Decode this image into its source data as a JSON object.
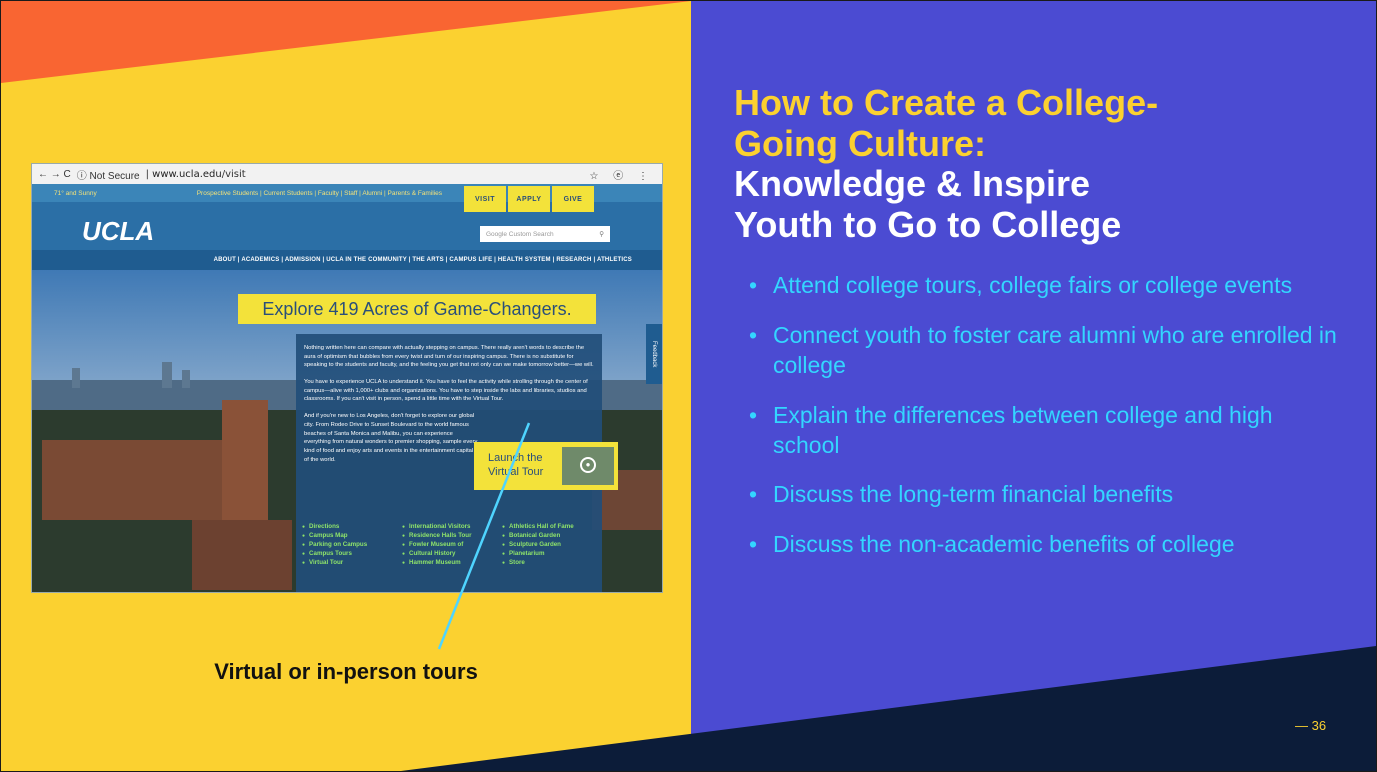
{
  "colors": {
    "yellow": "#fbd130",
    "orange": "#f96532",
    "purple": "#4b4bd2",
    "navy": "#0c1c39",
    "cyan": "#33d6ff",
    "ucla_blue": "#2b6fa6",
    "ucla_gold": "#f3e23a",
    "link_green": "#8fe46a"
  },
  "screenshot": {
    "browser": {
      "nav_icons": "← → C",
      "not_secure": "ⓘ Not Secure",
      "url_host": "www.ucla.edu",
      "url_path": "/visit",
      "right_icons": "☆ ⓔ ⋮"
    },
    "weather": "71° and Sunny",
    "audience_links": "Prospective Students  |  Current Students  |  Faculty  |  Staff  |  Alumni  |  Parents & Families",
    "cta": [
      "VISIT",
      "APPLY",
      "GIVE"
    ],
    "logo": "UCLA",
    "search_placeholder": "Google Custom Search",
    "nav": "ABOUT  |  ACADEMICS  |  ADMISSION  |  UCLA IN THE COMMUNITY  |  THE ARTS  |  CAMPUS LIFE  |  HEALTH SYSTEM  |  RESEARCH  |  ATHLETICS",
    "hero": "Explore 419 Acres of Game-Changers.",
    "feedback": "Feedback",
    "paragraphs": [
      "Nothing written here can compare with actually stepping on campus. There really aren't words to describe the aura of optimism that bubbles from every twist and turn of our inspiring campus. There is no substitute for speaking to the students and faculty, and the feeling you get that not only can we make tomorrow better—we will.",
      "You have to experience UCLA to understand it. You have to feel the activity while strolling through the center of campus—alive with 1,000+ clubs and organizations. You have to step inside the labs and libraries, studios and classrooms. If you can't visit in person, spend a little time with the Virtual Tour.",
      "And if you're new to Los Angeles, don't forget to explore our global city. From Rodeo Drive to Sunset Boulevard to the world famous beaches of Santa Monica and Malibu, you can experience everything from natural wonders to premier shopping, sample every kind of food and enjoy arts and events in the entertainment capital of the world."
    ],
    "virtual_tour": "Launch the Virtual Tour",
    "links_col1": [
      "Directions",
      "Campus Map",
      "Parking on Campus",
      "Campus Tours",
      "Virtual Tour"
    ],
    "links_col2": [
      "International Visitors",
      "Residence Halls Tour",
      "Fowler Museum of",
      "Cultural History",
      "Hammer Museum"
    ],
    "links_col3": [
      "Athletics Hall of Fame",
      "Botanical Garden",
      "Sculpture Garden",
      "Planetarium",
      "Store"
    ]
  },
  "caption": "Virtual or in-person tours",
  "title": {
    "line1": "How to Create a College-",
    "line2": "Going Culture:",
    "line3": "Knowledge & Inspire",
    "line4": "Youth to Go to College"
  },
  "bullets": [
    "Attend college tours, college fairs or college events",
    "Connect youth to foster care alumni who are enrolled in college",
    "Explain the differences between college and high school",
    "Discuss the long-term financial benefits",
    "Discuss the non-academic benefits of college"
  ],
  "page_number": "— 36"
}
